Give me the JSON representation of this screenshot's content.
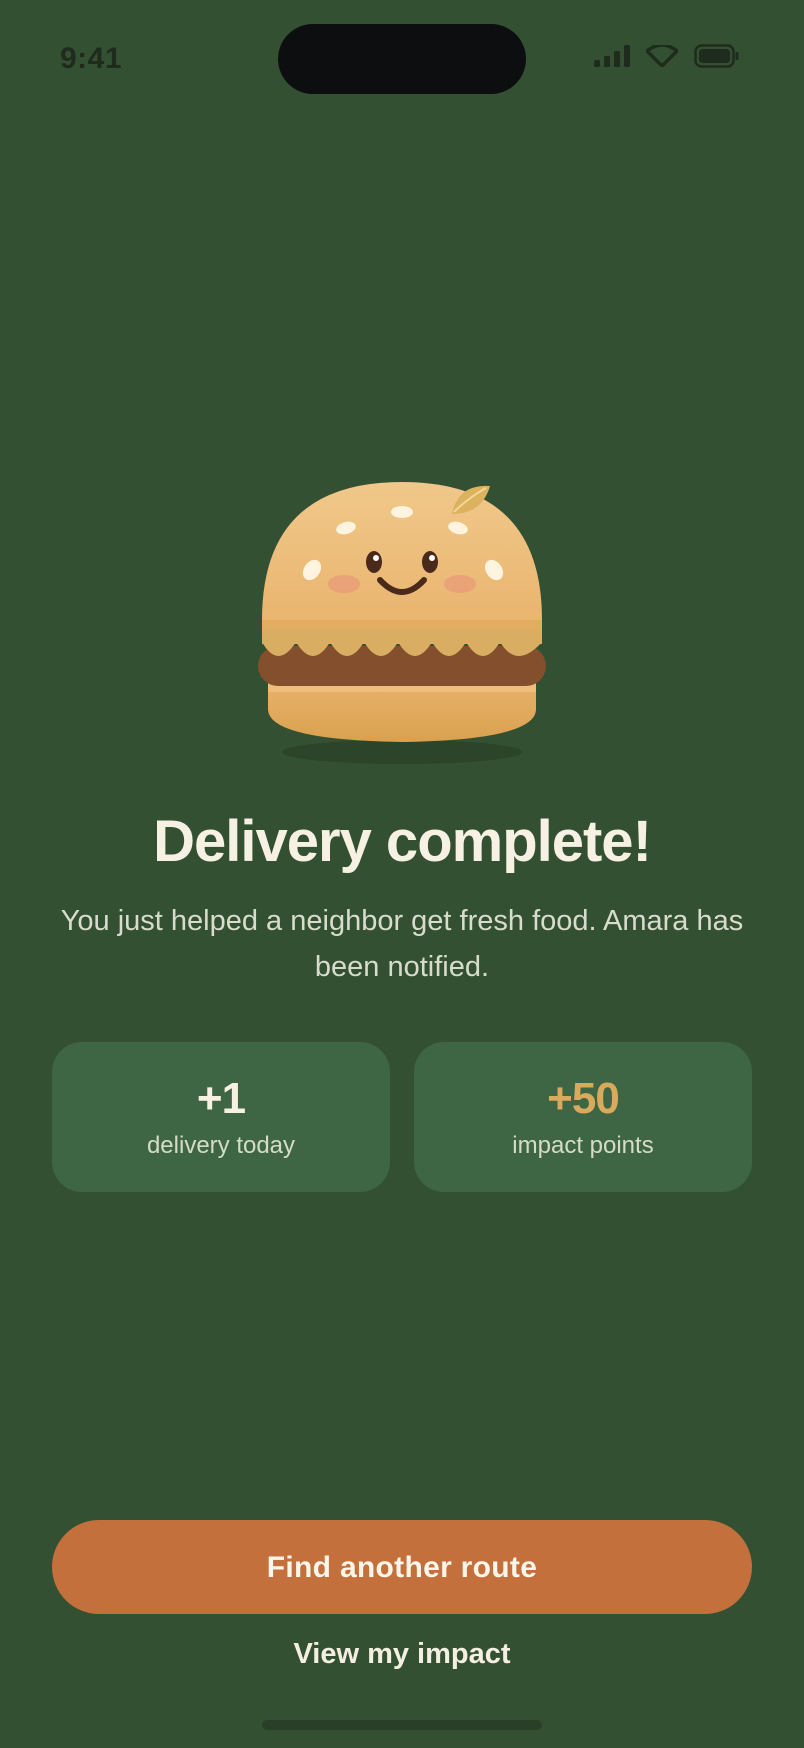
{
  "status_bar": {
    "time": "9:41",
    "icons": [
      "signal-icon",
      "wifi-icon",
      "battery-icon"
    ]
  },
  "hero": {
    "illustration": "burger-mascot-illustration"
  },
  "title": "Delivery complete!",
  "subtitle": "You just helped a neighbor get fresh food. Amara has been notified.",
  "stats": [
    {
      "value": "+1",
      "label": "delivery today",
      "color": "#f6f1e3"
    },
    {
      "value": "+50",
      "label": "impact points",
      "color": "#d9a95c"
    }
  ],
  "actions": {
    "primary": "Find another route",
    "secondary": "View my impact"
  },
  "colors": {
    "background": "#345032",
    "card": "#3e6644",
    "primary_button": "#c3703d",
    "accent": "#d9a95c"
  }
}
